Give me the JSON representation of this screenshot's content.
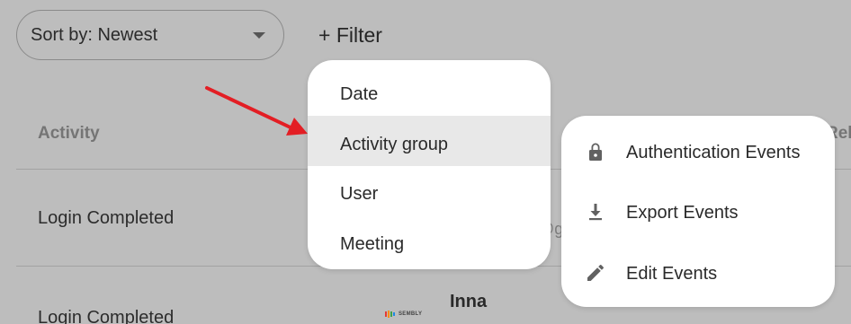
{
  "sort": {
    "label": "Sort by: Newest",
    "icon": "chevron-down-icon"
  },
  "filter": {
    "label": "+ Filter"
  },
  "table": {
    "columns": [
      "Activity",
      "Rel"
    ],
    "rows": [
      {
        "activity": "Login Completed",
        "email_fragment": "@g"
      },
      {
        "activity": "Login Completed",
        "user": "Inna",
        "logo_text": "SEMBLY"
      }
    ]
  },
  "filter_menu": {
    "items": [
      {
        "label": "Date"
      },
      {
        "label": "Activity group",
        "highlighted": true
      },
      {
        "label": "User"
      },
      {
        "label": "Meeting"
      }
    ]
  },
  "activity_group_submenu": {
    "items": [
      {
        "label": "Authentication Events",
        "icon": "lock-icon"
      },
      {
        "label": "Export Events",
        "icon": "download-icon"
      },
      {
        "label": "Edit Events",
        "icon": "pencil-icon"
      }
    ]
  },
  "colors": {
    "background": "#bdbdbd",
    "menu_bg": "#ffffff",
    "menu_highlight": "#e8e8e8",
    "arrow": "#e31e24"
  }
}
